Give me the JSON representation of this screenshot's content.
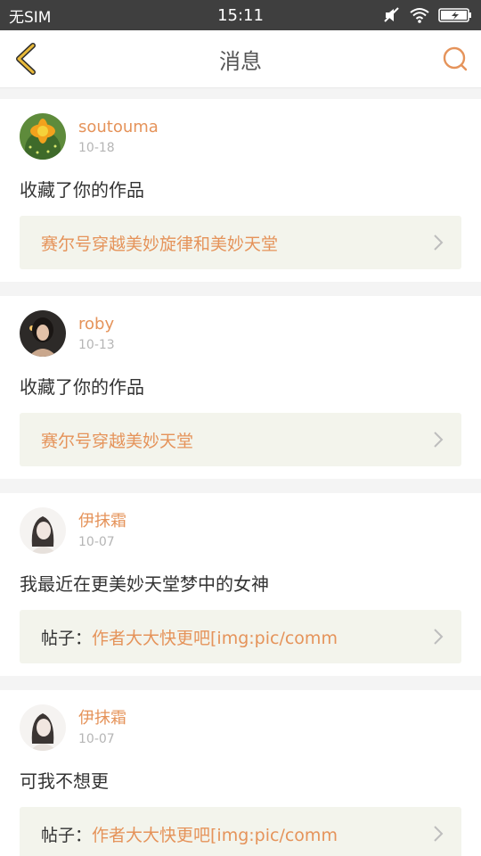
{
  "status_bar": {
    "carrier": "无SIM",
    "time": "15:11"
  },
  "header": {
    "title": "消息",
    "back_icon": "back-chevron-icon",
    "search_icon": "search-icon"
  },
  "colors": {
    "accent": "#e5935a",
    "back_icon": "#e8b93a",
    "link_bg": "#f3f4ec"
  },
  "messages": [
    {
      "username": "soutouma",
      "date": "10-18",
      "text": "收藏了你的作品",
      "link_prefix": "",
      "link_text": "赛尔号穿越美妙旋律和美妙天堂"
    },
    {
      "username": "roby",
      "date": "10-13",
      "text": "收藏了你的作品",
      "link_prefix": "",
      "link_text": "赛尔号穿越美妙天堂"
    },
    {
      "username": "伊抹霜",
      "date": "10-07",
      "text": "我最近在更美妙天堂梦中的女神",
      "link_prefix": "帖子：",
      "link_text": "作者大大快更吧[img:pic/comm"
    },
    {
      "username": "伊抹霜",
      "date": "10-07",
      "text": "可我不想更",
      "link_prefix": "帖子：",
      "link_text": "作者大大快更吧[img:pic/comm"
    }
  ]
}
